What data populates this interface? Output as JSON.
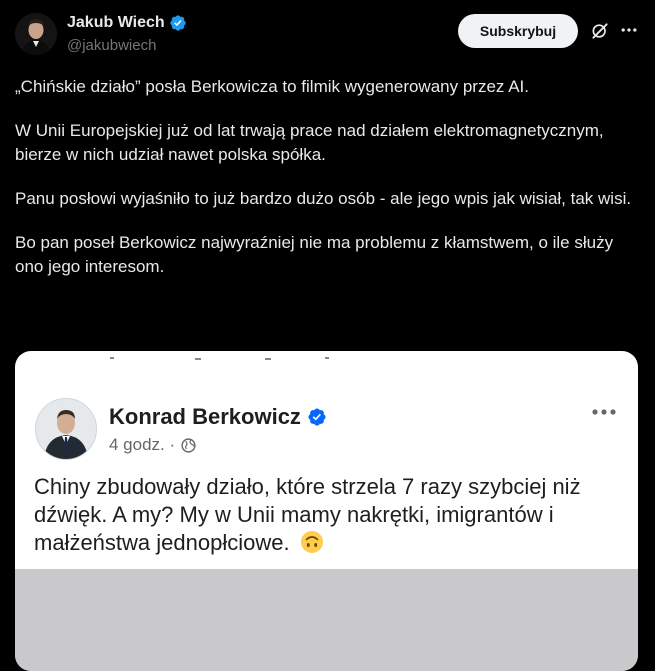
{
  "author": {
    "name": "Jakub Wiech",
    "handle": "@jakubwiech",
    "verified": true
  },
  "actions": {
    "subscribe_label": "Subskrybuj"
  },
  "post": {
    "paragraphs": [
      "„Chińskie działo” posła Berkowicza to filmik wygenerowany przez AI.",
      "W Unii Europejskiej już od lat trwają prace nad działem elektromagnetycznym, bierze w nich udział nawet polska spółka.",
      "Panu posłowi wyjaśniło to już bardzo dużo osób - ale jego wpis jak wisiał, tak wisi.",
      "Bo pan poseł Berkowicz najwyraźniej nie ma problemu z kłamstwem, o ile służy ono jego interesom."
    ]
  },
  "embedded_post": {
    "author_name": "Konrad Berkowicz",
    "time": "4 godz. ·",
    "text": "Chiny zbudowały działo, które strzela 7 razy szybciej niż dźwięk. A my? My w Unii mamy nakrętki, imigrantów i małżeństwa jednopłciowe.",
    "emoji": "upside-down-face"
  },
  "colors": {
    "background": "#000000",
    "text": "#e7e9ea",
    "muted": "#71767b",
    "verified": "#1d9bf0",
    "card_background": "#ffffff",
    "fb_verified": "#0866ff"
  }
}
